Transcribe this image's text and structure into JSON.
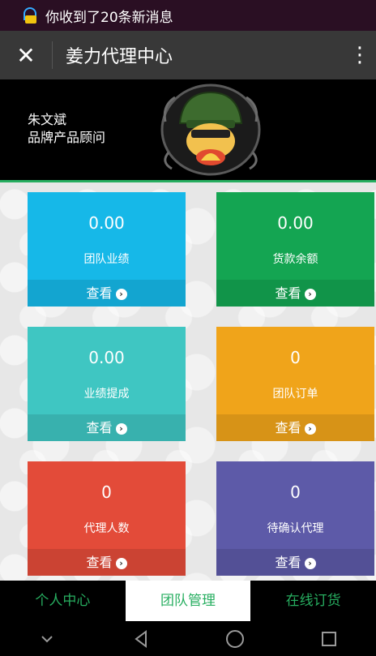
{
  "status_bar": {
    "notification": "你收到了20条新消息"
  },
  "header": {
    "title": "姜力代理中心",
    "close_glyph": "✕",
    "more_glyph": "⋮"
  },
  "profile": {
    "name": "朱文斌",
    "role": "品牌产品顾问"
  },
  "tiles": [
    {
      "value": "0.00",
      "label": "团队业绩",
      "action": "查看",
      "color": "#16b8e8"
    },
    {
      "value": "0.00",
      "label": "货款余额",
      "action": "查看",
      "color": "#14a552"
    },
    {
      "value": "0.00",
      "label": "业绩提成",
      "action": "查看",
      "color": "#3fc6c2"
    },
    {
      "value": "0",
      "label": "团队订单",
      "action": "查看",
      "color": "#f0a41a"
    },
    {
      "value": "0",
      "label": "代理人数",
      "action": "查看",
      "color": "#e34b39"
    },
    {
      "value": "0",
      "label": "待确认代理",
      "action": "查看",
      "color": "#5d5aa8"
    }
  ],
  "tab_bar": {
    "tabs": [
      {
        "label": "个人中心"
      },
      {
        "label": "团队管理",
        "active": true
      },
      {
        "label": "在线订货"
      }
    ]
  },
  "icons": {
    "status": "notification-icon",
    "close": "close-icon",
    "more": "more-icon",
    "avatar": "avatar-image",
    "view": "arrow-right-circle-icon"
  }
}
